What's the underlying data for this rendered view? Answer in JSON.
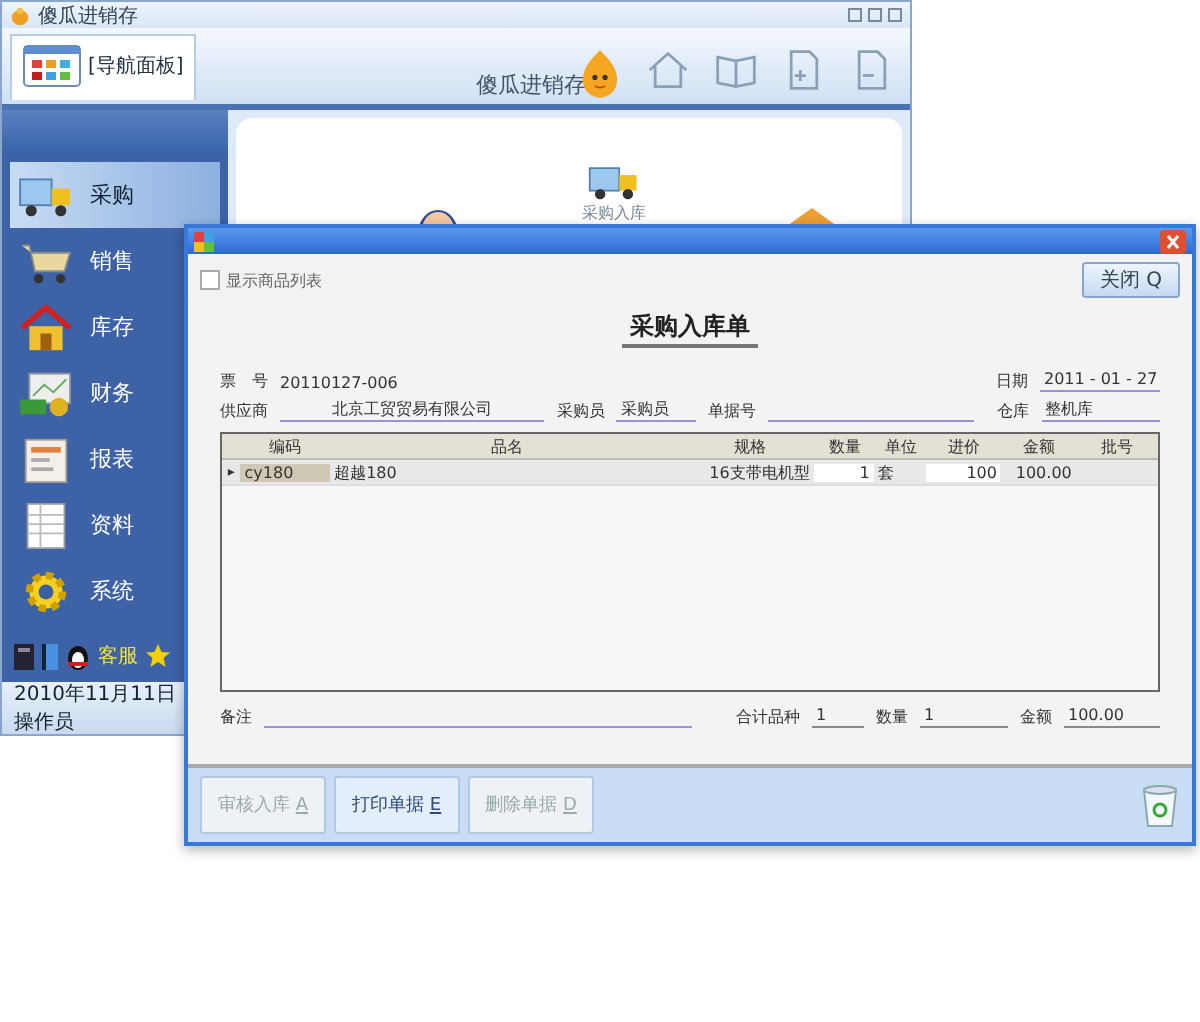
{
  "app_window": {
    "title": "傻瓜进销存",
    "nav_tab": "[导航面板]",
    "logo_text": "傻瓜进销存"
  },
  "sidebar": {
    "items": [
      {
        "label": "采购",
        "kind": "truck",
        "selected": true
      },
      {
        "label": "销售",
        "kind": "cart",
        "selected": false
      },
      {
        "label": "库存",
        "kind": "house",
        "selected": false
      },
      {
        "label": "财务",
        "kind": "money",
        "selected": false
      },
      {
        "label": "报表",
        "kind": "report",
        "selected": false
      },
      {
        "label": "资料",
        "kind": "sheet",
        "selected": false
      },
      {
        "label": "系统",
        "kind": "gear",
        "selected": false
      }
    ]
  },
  "sidebar_footer": {
    "service": "客服",
    "date": "2010年11月11日",
    "operator": "操作员"
  },
  "canvas": {
    "label": "采购入库"
  },
  "dialog": {
    "show_list": {
      "label": "显示商品列表",
      "checked": false
    },
    "close_button": "关闭",
    "close_key": "Q",
    "form_title": "采购入库单",
    "bill_no_label": "票　号",
    "bill_no": "20110127-006",
    "date_label": "日期",
    "date": "2011 - 01 - 27",
    "supplier_label": "供应商",
    "supplier": "北京工贸贸易有限公司",
    "buyer_label": "采购员",
    "buyer": "采购员",
    "doc_no_label": "单据号",
    "warehouse_label": "仓库",
    "warehouse": "整机库",
    "table": {
      "columns": [
        "编码",
        "品名",
        "规格",
        "数量",
        "单位",
        "进价",
        "金额",
        "批号"
      ],
      "rows": [
        {
          "marker": "▸",
          "cells": [
            "cy180",
            "超越180",
            "16支带电机型",
            "1",
            "套",
            "100",
            "100.00",
            ""
          ]
        }
      ]
    },
    "remark_label": "备注",
    "total_kinds_label": "合计品种",
    "total_kinds": "1",
    "qty_label": "数量",
    "qty": "1",
    "amount_label": "金额",
    "amount": "100.00",
    "buttons": [
      {
        "label": "审核入库",
        "key": "A",
        "disabled": true
      },
      {
        "label": "打印单据",
        "key": "E",
        "disabled": false
      },
      {
        "label": "删除单据",
        "key": "D",
        "disabled": true
      }
    ]
  }
}
